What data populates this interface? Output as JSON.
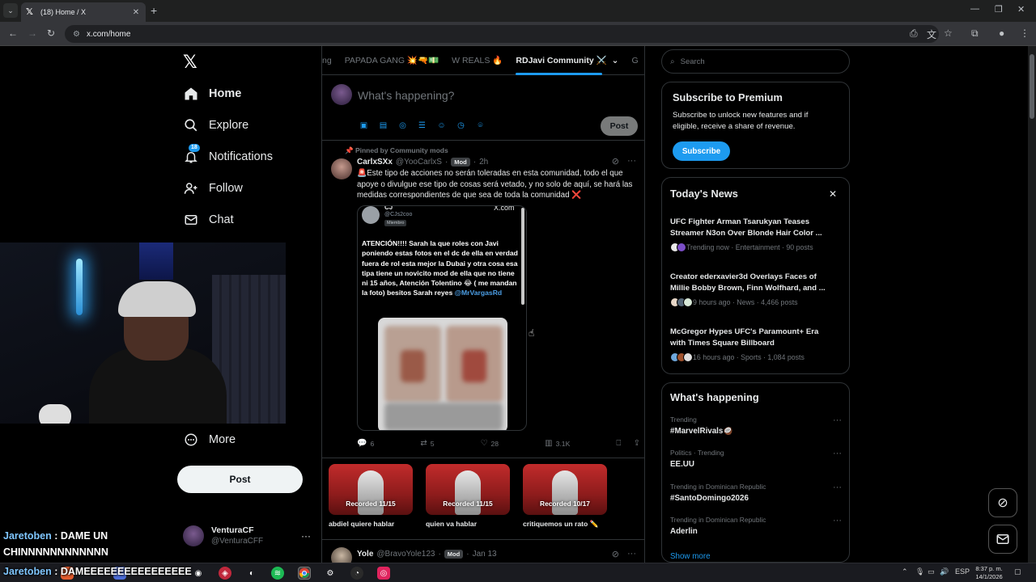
{
  "browser": {
    "tab_title": "(18) Home / X",
    "url": "x.com/home"
  },
  "sidebar": {
    "items": [
      {
        "label": "Home",
        "icon": "home-icon"
      },
      {
        "label": "Explore",
        "icon": "search-icon"
      },
      {
        "label": "Notifications",
        "icon": "bell-icon",
        "badge": "18"
      },
      {
        "label": "Follow",
        "icon": "person-add-icon"
      },
      {
        "label": "Chat",
        "icon": "mail-icon"
      },
      {
        "label": "More",
        "icon": "more-circle-icon"
      }
    ],
    "post_label": "Post",
    "account": {
      "name": "VenturaCF",
      "handle": "@VenturaCFF"
    }
  },
  "stream_chat": [
    {
      "user": "Jaretoben",
      "text": " : DAME UN"
    },
    {
      "user": "",
      "text": "CHINNNNNNNNNNNN"
    },
    {
      "user": "Jaretoben",
      "text": " : DAMEEEEEEEEEEEEEEEE"
    }
  ],
  "center": {
    "tabs": [
      "ng",
      "PAPADA GANG 💥🔫💵",
      "W REALS 🔥",
      "RDJavi Community ⚔️",
      "G"
    ],
    "compose_placeholder": "What's happening?",
    "compose_post": "Post",
    "tweet": {
      "pinned": "Pinned by Community mods",
      "name": "CarlxSXx",
      "handle": "@YooCarlxS",
      "badge": "Mod",
      "time": "2h",
      "text": "🚨Este tipo de acciones no serán toleradas en esta comunidad, todo el que apoye o divulgue ese tipo de cosas será vetado, y no solo de aquí, se hará las medidas correspondientes de que sea de toda la comunidad ❌",
      "embed": {
        "name": "CJ",
        "handle": "@CJs2coo",
        "role": "Miembro",
        "site": "X.com",
        "text": "ATENCIÓN!!!! Sarah la que roles con Javi poniendo estas fotos en el dc de ella en verdad fuera de rol esta mejor la Dubai y otra cosa esa tipa tiene un novicito mod de ella que no tiene ni 15 años, Atención Tolentino 😂 ( me mandan la foto) besitos Sarah reyes ",
        "mention": "@MrVargasRd"
      },
      "replies": "6",
      "reposts": "5",
      "likes": "28",
      "views": "3.1K"
    },
    "recordings": [
      {
        "label": "Recorded 11/15",
        "title": "abdiel quiere hablar"
      },
      {
        "label": "Recorded 11/15",
        "title": "quien va hablar"
      },
      {
        "label": "Recorded 10/17",
        "title": "critiquemos un rato ✏️"
      }
    ],
    "tweet2": {
      "name": "Yole",
      "handle": "@BravoYole123",
      "badge": "Mod",
      "time": "Jan 13"
    }
  },
  "right": {
    "search_placeholder": "Search",
    "premium": {
      "title": "Subscribe to Premium",
      "body": "Subscribe to unlock new features and if eligible, receive a share of revenue.",
      "button": "Subscribe"
    },
    "news": {
      "title": "Today's News",
      "items": [
        {
          "title": "UFC Fighter Arman Tsarukyan Teases Streamer N3on Over Blonde Hair Color ...",
          "meta": "Trending now · Entertainment · 90 posts"
        },
        {
          "title": "Creator ederxavier3d Overlays Faces of Millie Bobby Brown, Finn Wolfhard, and ...",
          "meta": "9 hours ago · News · 4,466 posts"
        },
        {
          "title": "McGregor Hypes UFC's Paramount+ Era with Times Square Billboard",
          "meta": "16 hours ago · Sports · 1,084 posts"
        }
      ]
    },
    "happening": {
      "title": "What's happening",
      "trends": [
        {
          "context": "Trending",
          "name": "#MarvelRivals🥥"
        },
        {
          "context": "Politics · Trending",
          "name": "EE.UU"
        },
        {
          "context": "Trending in Dominican Republic",
          "name": "#SantoDomingo2026"
        },
        {
          "context": "Trending in Dominican Republic",
          "name": "Aderlin"
        }
      ],
      "show_more": "Show more"
    }
  },
  "taskbar": {
    "lang": "ESP",
    "time": "8:37 p. m.",
    "date": "14/1/2026"
  },
  "colors": {
    "accent": "#1d9bf0",
    "background": "#000000",
    "border": "#2f3336"
  }
}
